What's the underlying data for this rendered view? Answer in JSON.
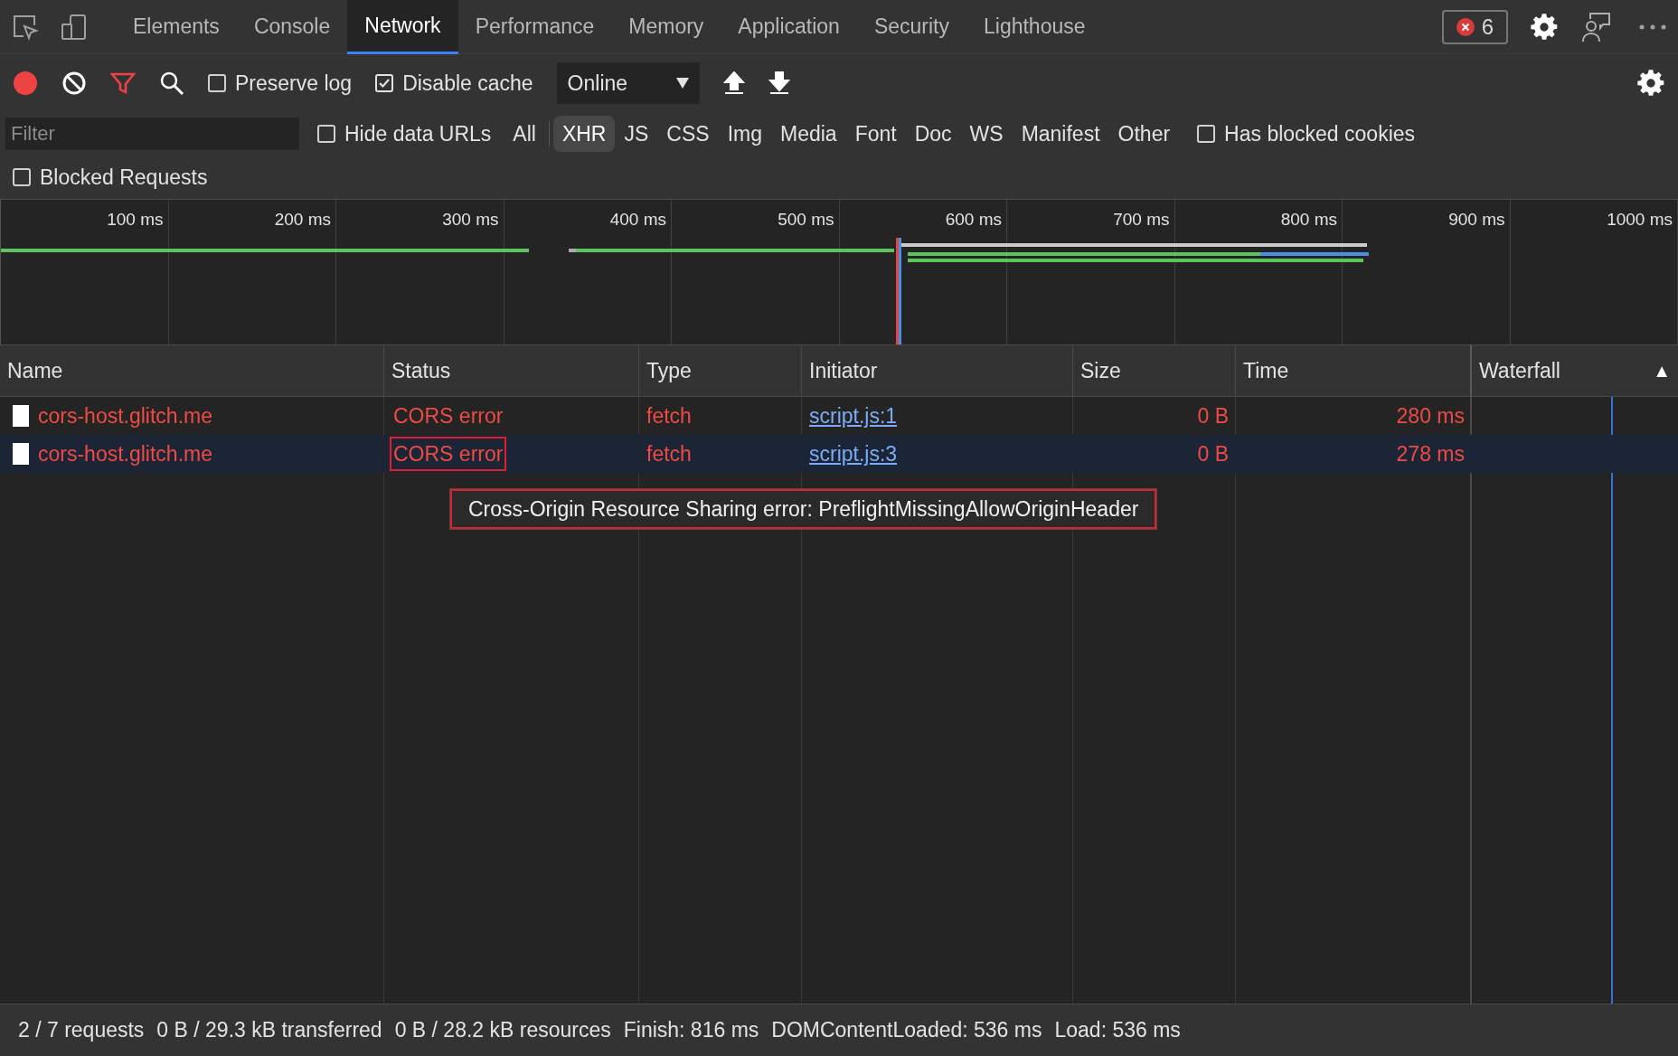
{
  "tabs": [
    {
      "label": "Elements",
      "selected": false
    },
    {
      "label": "Console",
      "selected": false
    },
    {
      "label": "Network",
      "selected": true
    },
    {
      "label": "Performance",
      "selected": false
    },
    {
      "label": "Memory",
      "selected": false
    },
    {
      "label": "Application",
      "selected": false
    },
    {
      "label": "Security",
      "selected": false
    },
    {
      "label": "Lighthouse",
      "selected": false
    }
  ],
  "error_count": "6",
  "toolbar": {
    "recording": true,
    "preserve_log": {
      "label": "Preserve log",
      "checked": false
    },
    "disable_cache": {
      "label": "Disable cache",
      "checked": true
    },
    "throttling": "Online"
  },
  "filter": {
    "placeholder": "Filter",
    "hide_data_urls": {
      "label": "Hide data URLs",
      "checked": false
    },
    "types": [
      {
        "label": "All",
        "selected": false
      },
      {
        "label": "XHR",
        "selected": true
      },
      {
        "label": "JS",
        "selected": false
      },
      {
        "label": "CSS",
        "selected": false
      },
      {
        "label": "Img",
        "selected": false
      },
      {
        "label": "Media",
        "selected": false
      },
      {
        "label": "Font",
        "selected": false
      },
      {
        "label": "Doc",
        "selected": false
      },
      {
        "label": "WS",
        "selected": false
      },
      {
        "label": "Manifest",
        "selected": false
      },
      {
        "label": "Other",
        "selected": false
      }
    ],
    "has_blocked_cookies": {
      "label": "Has blocked cookies",
      "checked": false
    },
    "blocked_requests": {
      "label": "Blocked Requests",
      "checked": false
    }
  },
  "timeline": {
    "ticks": [
      "100 ms",
      "200 ms",
      "300 ms",
      "400 ms",
      "500 ms",
      "600 ms",
      "700 ms",
      "800 ms",
      "900 ms",
      "1000 ms"
    ]
  },
  "table": {
    "columns": [
      "Name",
      "Status",
      "Type",
      "Initiator",
      "Size",
      "Time",
      "Waterfall"
    ],
    "sort_indicator": "▲",
    "rows": [
      {
        "name": "cors-host.glitch.me",
        "status": "CORS error",
        "status_outlined": false,
        "type": "fetch",
        "initiator": "script.js:1",
        "size": "0 B",
        "time": "280 ms",
        "selected": false
      },
      {
        "name": "cors-host.glitch.me",
        "status": "CORS error",
        "status_outlined": true,
        "type": "fetch",
        "initiator": "script.js:3",
        "size": "0 B",
        "time": "278 ms",
        "selected": true
      }
    ]
  },
  "tooltip": {
    "text": "Cross-Origin Resource Sharing error: PreflightMissingAllowOriginHeader",
    "outlined": true
  },
  "status_bar": [
    "2 / 7 requests",
    "0 B / 29.3 kB transferred",
    "0 B / 28.2 kB resources",
    "Finish: 816 ms",
    "DOMContentLoaded: 536 ms",
    "Load: 536 ms"
  ]
}
